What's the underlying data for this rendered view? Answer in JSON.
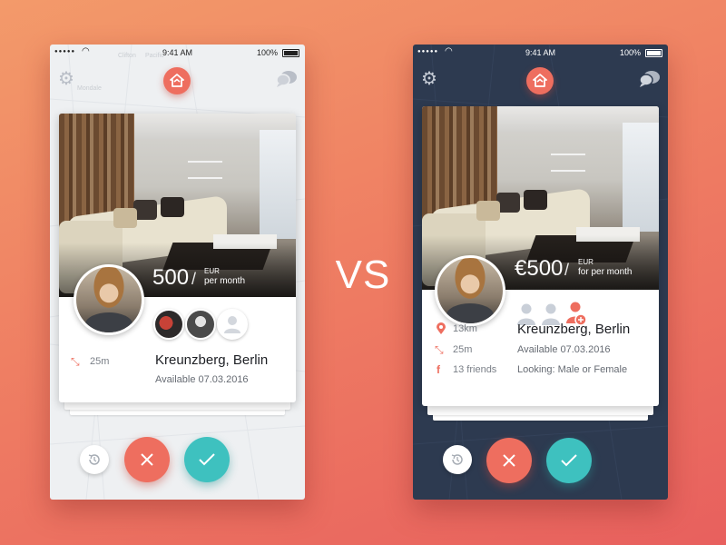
{
  "comparison_label": "VS",
  "colors": {
    "accent": "#ee6e5f",
    "accept": "#3ec1bf",
    "dark_bg": "#2d3a50",
    "light_bg": "#eef0f2"
  },
  "light": {
    "status": {
      "time": "9:41 AM",
      "battery": "100%"
    },
    "price": {
      "amount": "500",
      "separator": "/",
      "currency": "EUR",
      "period": "per month"
    },
    "listing": {
      "title": "Kreunzberg, Berlin",
      "available": "Available 07.03.2016"
    },
    "meta": {
      "distance": "25m"
    },
    "map_labels": [
      "Clifton",
      "Pacific",
      "Mondale"
    ],
    "icons": {
      "settings": "gear-icon",
      "chat": "chat-bubbles-icon",
      "history": "history-icon",
      "reject": "close-icon",
      "accept": "check-icon",
      "size": "expand-icon"
    }
  },
  "dark": {
    "status": {
      "time": "9:41 AM",
      "battery": "100%"
    },
    "price": {
      "amount": "€500",
      "separator": "/",
      "currency": "EUR",
      "period": "for per month"
    },
    "listing": {
      "title": "Kreunzberg, Berlin",
      "available": "Available 07.03.2016",
      "looking": "Looking: Male or Female"
    },
    "meta": {
      "location": "13km",
      "distance": "25m",
      "friends": "13 friends"
    },
    "icons": {
      "settings": "gear-icon",
      "chat": "chat-bubbles-icon",
      "location": "map-pin-icon",
      "size": "expand-icon",
      "friends": "facebook-icon",
      "history": "history-icon",
      "reject": "close-icon",
      "accept": "check-icon"
    }
  }
}
